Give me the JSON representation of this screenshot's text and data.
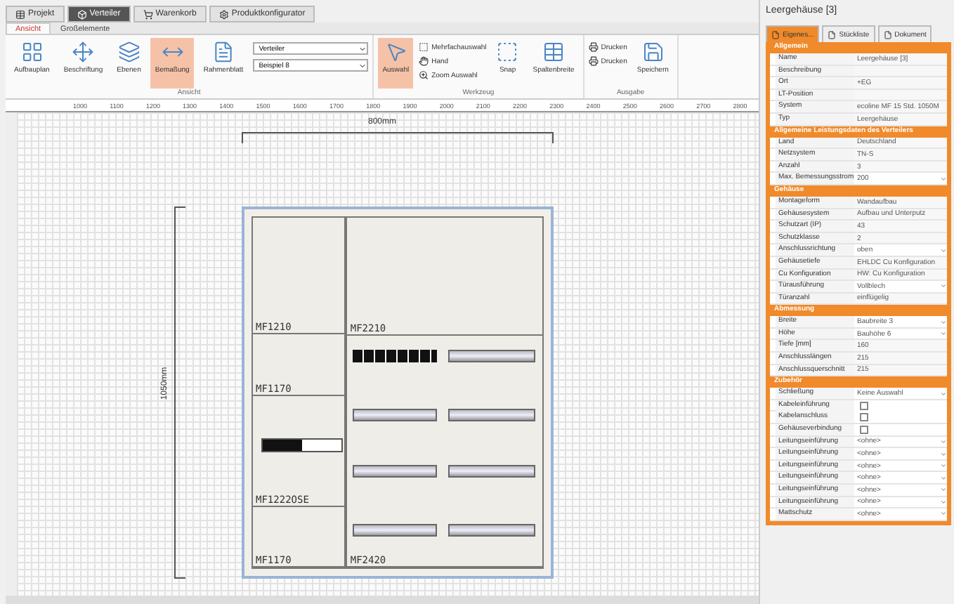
{
  "top_tabs": [
    {
      "label": "Projekt",
      "selected": false
    },
    {
      "label": "Verteiler",
      "selected": true
    },
    {
      "label": "Warenkorb",
      "selected": false
    },
    {
      "label": "Produktkonfigurator",
      "selected": false
    }
  ],
  "ribbon_tabs": [
    {
      "label": "Ansicht",
      "selected": true
    },
    {
      "label": "Großelemente",
      "selected": false
    }
  ],
  "ribbon_groups": [
    {
      "label": "Ansicht",
      "items": [
        {
          "kind": "large",
          "label": "Aufbauplan",
          "selected": false
        },
        {
          "kind": "large",
          "label": "Beschriftung",
          "selected": false
        },
        {
          "kind": "large",
          "label": "Ebenen",
          "selected": false
        },
        {
          "kind": "large",
          "label": "Bemaßung",
          "selected": true
        },
        {
          "kind": "large",
          "label": "Rahmenblatt",
          "selected": false
        },
        {
          "kind": "dropdowns",
          "fields": [
            "Verteiler",
            "Beispiel 8"
          ]
        }
      ]
    },
    {
      "label": "Werkzeug",
      "items": [
        {
          "kind": "large",
          "label": "Auswahl",
          "selected": true
        },
        {
          "kind": "smalls",
          "labels": [
            "Mehrfachauswahl",
            "Hand",
            "Zoom Auswahl"
          ]
        },
        {
          "kind": "large",
          "label": "Snap",
          "selected": false
        },
        {
          "kind": "large",
          "label": "Spaltenbreite",
          "selected": false
        }
      ]
    },
    {
      "label": "Ausgabe",
      "items": [
        {
          "kind": "smalls",
          "labels": [
            "Drucken",
            "Drucken"
          ]
        },
        {
          "kind": "large",
          "label": "Speichern",
          "selected": false
        }
      ]
    }
  ],
  "ruler": [
    "1000",
    "1100",
    "1200",
    "1300",
    "1400",
    "1500",
    "1600",
    "1700",
    "1800",
    "1900",
    "2000",
    "2100",
    "2200",
    "2300",
    "2400",
    "2500",
    "2600",
    "2700",
    "2800"
  ],
  "drawing": {
    "width_label": "800mm",
    "height_label": "1050mm",
    "left_modules": [
      "MF1210",
      "MF1170",
      "MF1222OSE",
      "MF1170"
    ],
    "right_modules": [
      "MF2210",
      "MF2420"
    ]
  },
  "panel": {
    "title": "Leergehäuse [3]",
    "tabs": [
      {
        "label": "Eigenes...",
        "selected": true
      },
      {
        "label": "Stückliste",
        "selected": false
      },
      {
        "label": "Dokument",
        "selected": false
      }
    ],
    "sections": [
      {
        "title": "Allgemein",
        "rows": [
          {
            "kind": "text",
            "label": "Name",
            "value": "Leergehäuse [3]"
          },
          {
            "kind": "text",
            "label": "Beschreibung",
            "value": ""
          },
          {
            "kind": "text",
            "label": "Ort",
            "value": "+EG"
          },
          {
            "kind": "text",
            "label": "LT-Position",
            "value": ""
          },
          {
            "kind": "text",
            "label": "System",
            "value": "ecoline MF 15 Std. 1050M"
          },
          {
            "kind": "text",
            "label": "Typ",
            "value": "Leergehäuse"
          }
        ]
      },
      {
        "title": "Allgemeine Leistungsdaten des Verteilers",
        "rows": [
          {
            "kind": "text",
            "label": "Land",
            "value": "Deutschland"
          },
          {
            "kind": "text",
            "label": "Netzsystem",
            "value": "TN-S"
          },
          {
            "kind": "text",
            "label": "Anzahl",
            "value": "3"
          },
          {
            "kind": "dropdown",
            "label": "Max. Bemessungsstrom",
            "value": "200"
          }
        ]
      },
      {
        "title": "Gehäuse",
        "rows": [
          {
            "kind": "text",
            "label": "Montageform",
            "value": "Wandaufbau"
          },
          {
            "kind": "text",
            "label": "Gehäusesystem",
            "value": "Aufbau und Unterputz"
          },
          {
            "kind": "text",
            "label": "Schutzart (IP)",
            "value": "43"
          },
          {
            "kind": "text",
            "label": "Schutzklasse",
            "value": "2"
          },
          {
            "kind": "dropdown",
            "label": "Anschlussrichtung",
            "value": "oben"
          },
          {
            "kind": "text",
            "label": "Gehäusetiefe",
            "value": "EHLDC Cu Konfiguration"
          },
          {
            "kind": "text",
            "label": "Cu Konfiguration",
            "value": "HW: Cu Konfiguration"
          },
          {
            "kind": "dropdown",
            "label": "Türausführung",
            "value": "Vollblech"
          },
          {
            "kind": "text",
            "label": "Türanzahl",
            "value": "einflügelig"
          }
        ]
      },
      {
        "title": "Abmessung",
        "rows": [
          {
            "kind": "dropdown",
            "label": "Breite",
            "value": "Baubreite 3"
          },
          {
            "kind": "dropdown",
            "label": "Höhe",
            "value": "Bauhöhe 6"
          },
          {
            "kind": "text",
            "label": "Tiefe [mm]",
            "value": "160"
          },
          {
            "kind": "text",
            "label": "Anschlusslängen",
            "value": "215"
          },
          {
            "kind": "text",
            "label": "Anschlussquerschnitt",
            "value": "215"
          }
        ]
      },
      {
        "title": "Zubehör",
        "rows": [
          {
            "kind": "dropdown",
            "label": "Schließung",
            "value": "Keine Auswahl"
          },
          {
            "kind": "checkbox",
            "label": "Kabeleinführung",
            "checked": false
          },
          {
            "kind": "checkbox",
            "label": "Kabelanschluss",
            "checked": false
          },
          {
            "kind": "checkbox",
            "label": "Gehäuseverbindung",
            "checked": false
          },
          {
            "kind": "dropdown",
            "label": "Leitungseinführung",
            "value": "<ohne>"
          },
          {
            "kind": "dropdown",
            "label": "Leitungseinführung",
            "value": "<ohne>"
          },
          {
            "kind": "dropdown",
            "label": "Leitungseinführung",
            "value": "<ohne>"
          },
          {
            "kind": "dropdown",
            "label": "Leitungseinführung",
            "value": "<ohne>"
          },
          {
            "kind": "dropdown",
            "label": "Leitungseinführung",
            "value": "<ohne>"
          },
          {
            "kind": "dropdown",
            "label": "Leitungseinführung",
            "value": "<ohne>"
          },
          {
            "kind": "dropdown",
            "label": "Mattschutz",
            "value": "<ohne>"
          }
        ]
      }
    ]
  }
}
